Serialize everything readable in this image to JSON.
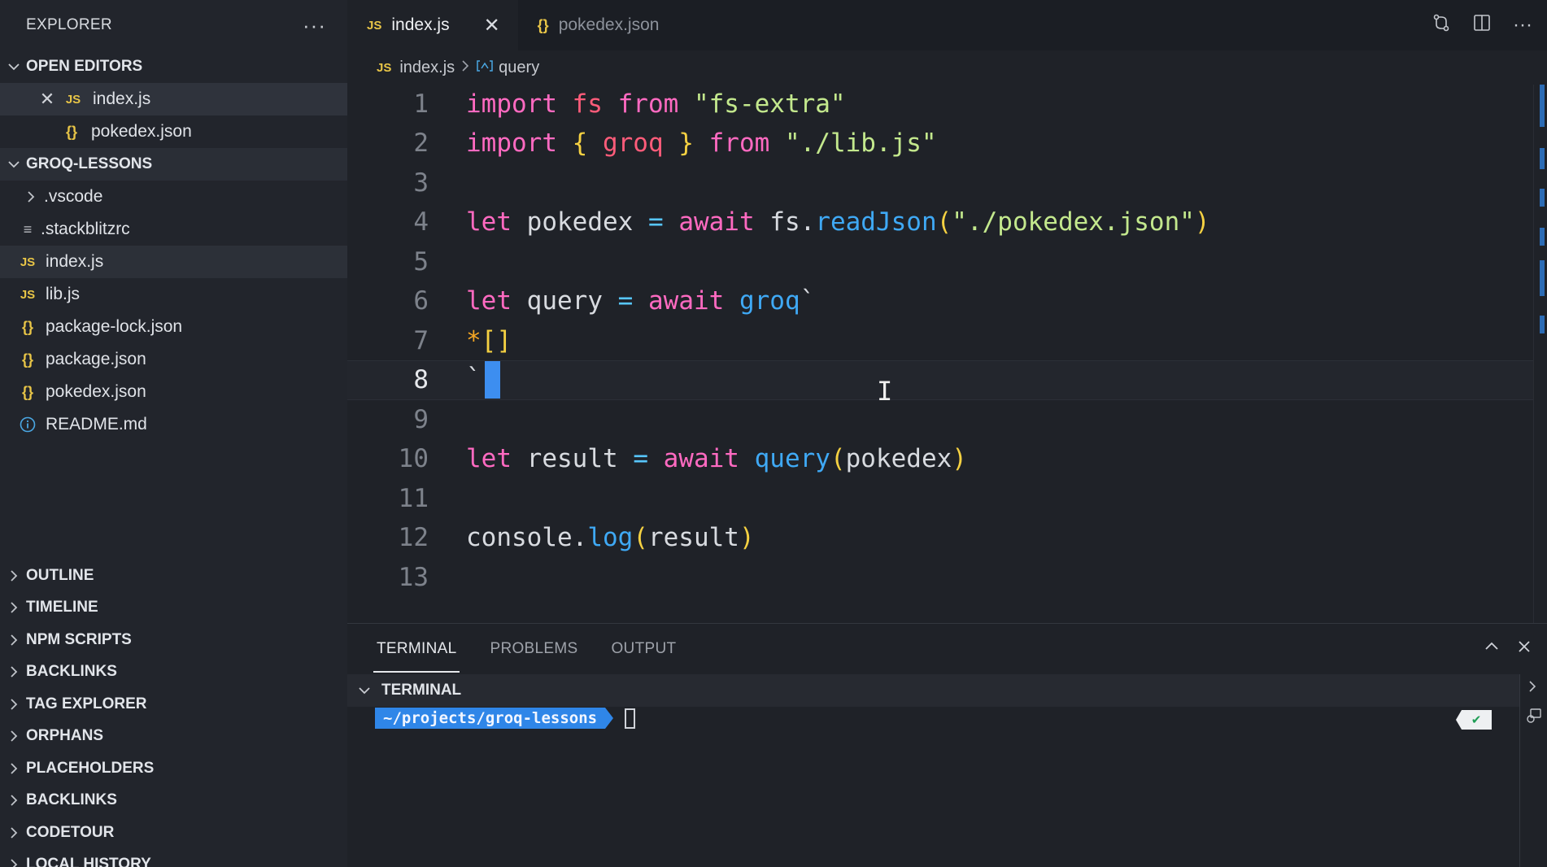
{
  "sidebar": {
    "title": "EXPLORER",
    "more_icon": "ellipsis-icon",
    "open_editors": {
      "label": "OPEN EDITORS",
      "items": [
        {
          "name": "index.js",
          "icon": "js-file-icon"
        },
        {
          "name": "pokedex.json",
          "icon": "json-file-icon"
        }
      ]
    },
    "project": {
      "label": "GROQ-LESSONS",
      "items": [
        {
          "name": ".vscode",
          "icon": "chevron-right-icon"
        },
        {
          "name": ".stackblitzrc",
          "icon": "lines-file-icon"
        },
        {
          "name": "index.js",
          "icon": "js-file-icon"
        },
        {
          "name": "lib.js",
          "icon": "js-file-icon"
        },
        {
          "name": "package-lock.json",
          "icon": "json-file-icon"
        },
        {
          "name": "package.json",
          "icon": "json-file-icon"
        },
        {
          "name": "pokedex.json",
          "icon": "json-file-icon"
        },
        {
          "name": "README.md",
          "icon": "info-icon"
        }
      ]
    },
    "bottom_sections": [
      "OUTLINE",
      "TIMELINE",
      "NPM SCRIPTS",
      "BACKLINKS",
      "TAG EXPLORER",
      "ORPHANS",
      "PLACEHOLDERS",
      "BACKLINKS",
      "CODETOUR",
      "LOCAL HISTORY"
    ]
  },
  "tabs": [
    {
      "label": "index.js",
      "icon_text": "JS",
      "active": true
    },
    {
      "label": "pokedex.json",
      "icon_text": "{}",
      "active": false
    }
  ],
  "breadcrumb": {
    "file": "index.js",
    "symbol": "query"
  },
  "editor": {
    "line_numbers": [
      "1",
      "2",
      "3",
      "4",
      "5",
      "6",
      "7",
      "8",
      "9",
      "10",
      "11",
      "12",
      "13"
    ],
    "current_line": "8",
    "code": {
      "l1": {
        "t1": "import",
        "t2": " fs ",
        "t3": "from",
        "t4": " \"fs-extra\""
      },
      "l2": {
        "t1": "import",
        "t2": " { ",
        "t3": "groq",
        "t4": " } ",
        "t5": "from",
        "t6": " \"./lib.js\""
      },
      "l4": {
        "t1": "let",
        "t2": " pokedex ",
        "t3": "=",
        "t4": " await ",
        "t5": "fs.",
        "t6": "readJson",
        "t7": "(",
        "t8": "\"./pokedex.json\"",
        "t9": ")"
      },
      "l6": {
        "t1": "let",
        "t2": " query ",
        "t3": "=",
        "t4": " await ",
        "t5": "groq",
        "t6": "`"
      },
      "l7": {
        "t1": "*",
        "t2": "[]"
      },
      "l8": {
        "t1": "`"
      },
      "l10": {
        "t1": "let",
        "t2": " result ",
        "t3": "=",
        "t4": " await ",
        "t5": "query",
        "t6": "(",
        "t7": "pokedex",
        "t8": ")"
      },
      "l12": {
        "t1": "console.",
        "t2": "log",
        "t3": "(",
        "t4": "result",
        "t5": ")"
      }
    }
  },
  "panel": {
    "tabs": [
      "TERMINAL",
      "PROBLEMS",
      "OUTPUT"
    ],
    "active_tab": "TERMINAL",
    "terminal_header": "TERMINAL",
    "prompt_path": "~/projects/groq-lessons",
    "status_icon": "check-icon"
  },
  "colors": {
    "accent": "#2f86e8",
    "keyword": "#ff6ac1",
    "string": "#c3e88d",
    "function": "#3fa9f5",
    "bracket": "#f5d142"
  }
}
